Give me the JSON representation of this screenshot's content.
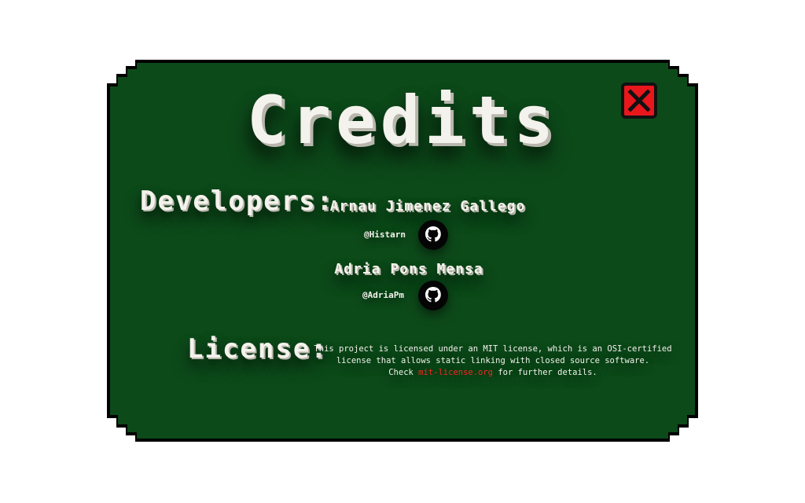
{
  "title": "Credits",
  "close_button": {
    "icon": "close-x-icon",
    "color": "#e8171c"
  },
  "developers": {
    "heading": "Developers:",
    "people": [
      {
        "name": "Arnau Jimenez Gallego",
        "handle": "@Histarn",
        "icon": "github-icon"
      },
      {
        "name": "Adria Pons Mensa",
        "handle": "@AdriaPm",
        "icon": "github-icon"
      }
    ]
  },
  "license": {
    "heading": "License:",
    "line1": "This project is licensed under an MIT license, which is an OSI-certified",
    "line2": "license that allows static linking with closed source software.",
    "line3_before": "Check ",
    "link_text": "mit-license.org",
    "line3_after": " for further details.",
    "link_color": "#ff2222"
  },
  "colors": {
    "panel": "#0d4a1a",
    "border": "#000000",
    "text": "#f4f2ec"
  }
}
